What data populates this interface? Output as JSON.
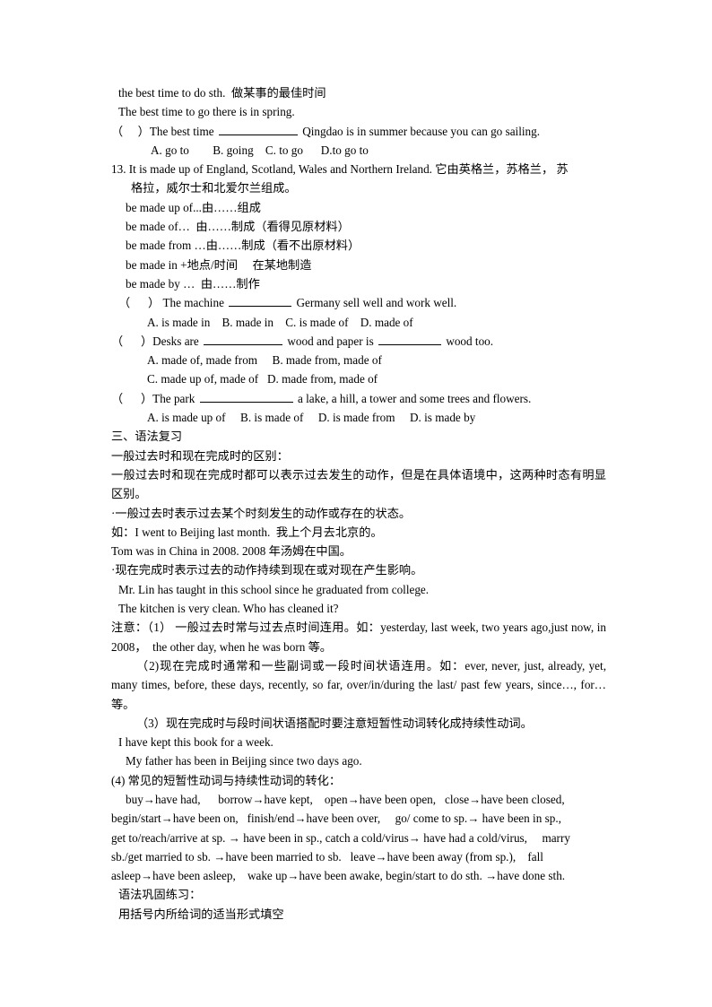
{
  "document": {
    "type": "english-grammar-review-worksheet",
    "language": "zh-CN + en",
    "page_background": "#ffffff",
    "text_color": "#000000"
  },
  "section_phrase": {
    "line1": "the best time to do sth.  做某事的最佳时间",
    "line2": "The best time to go there is in spring.",
    "question": {
      "bracket_open": "（",
      "bracket_close": "）",
      "stem_before": "The best time ",
      "stem_after": " Qingdao is in summer because you can go sailing.",
      "options": "A. go to        B. going    C. to go      D.to go to"
    }
  },
  "item13": {
    "number": "13.",
    "sentence": "It is made up of England, Scotland, Wales and Northern Ireland. 它由英格兰，苏格兰， 苏",
    "sentence_cont": "格拉，威尔士和北爱尔兰组成。",
    "phrases": [
      "be made up of...由……组成",
      "be made of…  由……制成（看得见原材料）",
      "be made from …由……制成（看不出原材料）",
      "be made in +地点/时间     在某地制造",
      "be made by …  由……制作"
    ],
    "q1": {
      "bracket_open": "（",
      "bracket_close": "）",
      "stem_before": " The machine ",
      "stem_after": " Germany sell well and work well.",
      "options": "A. is made in    B. made in    C. is made of    D. made of"
    },
    "q2": {
      "bracket_open": "（",
      "bracket_close": "）",
      "stem_before": "Desks are ",
      "stem_mid": " wood and paper is ",
      "stem_after": " wood too.",
      "options_line1": "A. made of, made from     B. made from, made of",
      "options_line2": "C. made up of, made of   D. made from, made of"
    },
    "q3": {
      "bracket_open": "（",
      "bracket_close": "）",
      "stem_before": "The park ",
      "stem_after": " a lake, a hill, a tower and some trees and flowers.",
      "options": "A. is made up of     B. is made of     D. is made from     D. is made by"
    }
  },
  "grammar": {
    "heading": "三、语法复习",
    "subheading": "一般过去时和现在完成时的区别：",
    "intro": "一般过去时和现在完成时都可以表示过去发生的动作，但是在具体语境中，这两种时态有明显区别。",
    "point1": "·一般过去时表示过去某个时刻发生的动作或存在的状态。",
    "example1_label": "如：",
    "example1": "如：I went to Beijing last month.  我上个月去北京的。",
    "example2": "Tom was in China in 2008. 2008 年汤姆在中国。",
    "point2": "·现在完成时表示过去的动作持续到现在或对现在产生影响。",
    "example3": "Mr. Lin has taught in this school since he graduated from college.",
    "example4": "The kitchen is very clean. Who has cleaned it?",
    "note1": "注意：（1） 一般过去时常与过去点时间连用。如：yesterday, last week, two years ago,just now, in 2008，  the other day, when he was born 等。",
    "note2": "（2)现在完成时通常和一些副词或一段时间状语连用。如：ever, never, just, already, yet, many times, before, these days, recently, so far, over/in/during the last/ past few years, since…, for…等。",
    "note3": "（3）现在完成时与段时间状语搭配时要注意短暂性动词转化成持续性动词。",
    "example5": "I have kept this book for a week.",
    "example6": "My father has been in Beijing since two days ago.",
    "note4": "(4) 常见的短暂性动词与持续性动词的转化：",
    "conversions_line1": "buy→have had,      borrow→have kept,    open→have been open,   close→have been closed,",
    "conversions_line2": "begin/start→have been on,   finish/end→have been over,     go/ come to sp.→ have been in sp.,",
    "conversions_line3": "get to/reach/arrive at sp. → have been in sp., catch a cold/virus→ have had a cold/virus,     marry",
    "conversions_line4": "sb./get married to sb. →have been married to sb.   leave→have been away (from sp.),    fall",
    "conversions_line5": "asleep→have been asleep,    wake up→have been awake, begin/start to do sth. →have done sth.",
    "practice_heading": "语法巩固练习：",
    "practice_instruction": "用括号内所给词的适当形式填空"
  }
}
